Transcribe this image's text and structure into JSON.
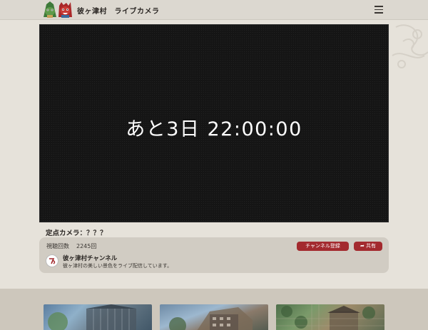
{
  "header": {
    "title": "彼ヶ津村　ライブカメラ",
    "logo_icon": "village-mascots-logo",
    "menu_icon": "hamburger-menu-icon"
  },
  "player": {
    "countdown": "あと3日 22:00:00"
  },
  "camera": {
    "label": "定点カメラ：？？？"
  },
  "info": {
    "views_label": "視聴回数",
    "views_count": "2245回",
    "subscribe_label": "チャンネル登録",
    "share_label": "共有",
    "share_icon": "share-arrow-icon",
    "channel_name": "彼ヶ津村チャンネル",
    "channel_desc": "彼ヶ津村の美しい景色をライブ配信しています。"
  },
  "colors": {
    "accent": "#a32a2e",
    "background": "#e6e2da",
    "player_bg": "#151515"
  },
  "thumbnails": [
    {
      "name": "thumbnail-1"
    },
    {
      "name": "thumbnail-2"
    },
    {
      "name": "thumbnail-3"
    }
  ]
}
